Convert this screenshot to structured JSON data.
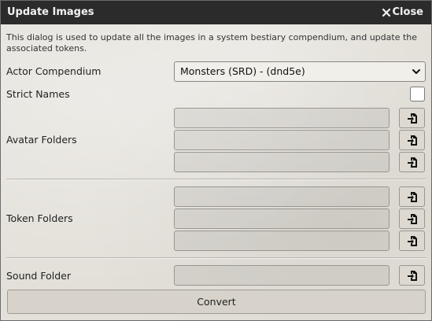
{
  "window": {
    "title": "Update Images",
    "close_label": "Close"
  },
  "description": "This dialog is used to update all the images in a system bestiary compendium, and update the associated tokens.",
  "actor_compendium": {
    "label": "Actor Compendium",
    "selected": "Monsters (SRD) - (dnd5e)"
  },
  "strict_names": {
    "label": "Strict Names",
    "checked": false
  },
  "avatar_folders": {
    "label": "Avatar Folders",
    "values": [
      "",
      "",
      ""
    ]
  },
  "token_folders": {
    "label": "Token Folders",
    "values": [
      "",
      "",
      ""
    ]
  },
  "sound_folder": {
    "label": "Sound Folder",
    "value": ""
  },
  "convert_label": "Convert",
  "icons": {
    "close": "x-icon",
    "dropdown": "chevron-down-icon",
    "file_picker": "file-import-icon"
  }
}
